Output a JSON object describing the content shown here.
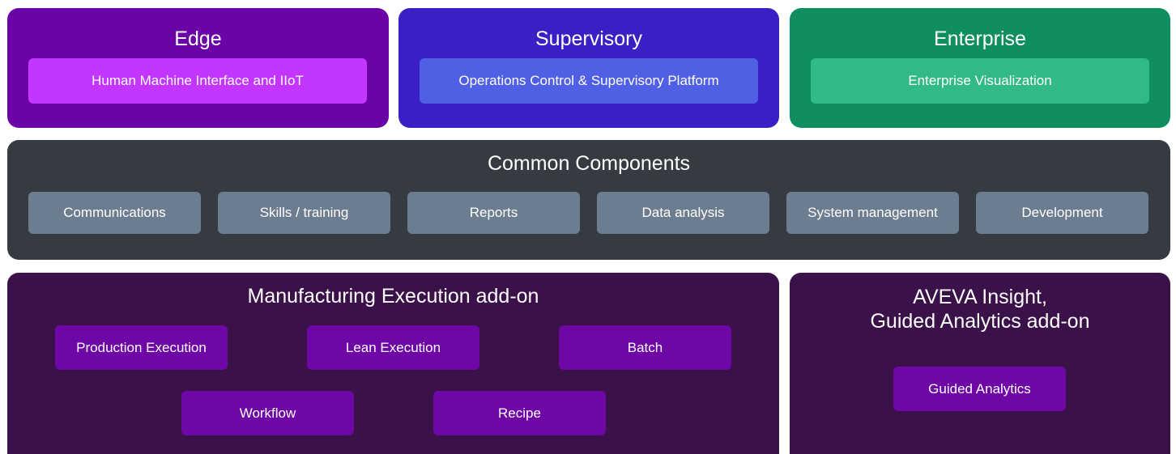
{
  "edge": {
    "title": "Edge",
    "item": "Human Machine Interface and IIoT",
    "colors": {
      "panel": "#6a04a6",
      "chip": "#c236ff"
    }
  },
  "supervisory": {
    "title": "Supervisory",
    "item": "Operations Control & Supervisory Platform",
    "colors": {
      "panel": "#3a20c4",
      "chip": "#4f60e5"
    }
  },
  "enterprise": {
    "title": "Enterprise",
    "item": "Enterprise Visualization",
    "colors": {
      "panel": "#0f8f60",
      "chip": "#31ba88"
    }
  },
  "common": {
    "title": "Common Components",
    "items": [
      "Communications",
      "Skills / training",
      "Reports",
      "Data analysis",
      "System management",
      "Development"
    ],
    "colors": {
      "panel": "#353b41",
      "chip": "#6c7d8f"
    }
  },
  "manufacturing": {
    "title": "Manufacturing Execution add-on",
    "items": [
      "Production Execution",
      "Lean Execution",
      "Batch",
      "Workflow",
      "Recipe"
    ],
    "colors": {
      "panel": "#3a1148",
      "chip": "#6e07a6"
    }
  },
  "aveva": {
    "title_line1": "AVEVA Insight,",
    "title_line2": "Guided Analytics add-on",
    "item": "Guided Analytics",
    "colors": {
      "panel": "#3a1148",
      "chip": "#6e07a6"
    }
  }
}
